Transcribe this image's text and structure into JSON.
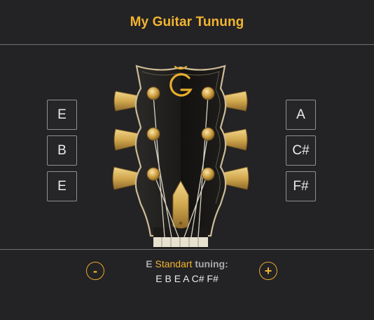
{
  "header": {
    "title": "My Guitar Tunung"
  },
  "left_pegs": [
    "E",
    "B",
    "E"
  ],
  "right_pegs": [
    "A",
    "C#",
    "F#"
  ],
  "tuning": {
    "prefix": "E",
    "name": "Standart",
    "suffix": "tuning:",
    "notes": "E B E A C# F#"
  },
  "controls": {
    "minus": "-",
    "plus": "+"
  },
  "logo_icon": "guitar-brand-logo",
  "colors": {
    "accent": "#f2b531",
    "background": "#232225"
  }
}
